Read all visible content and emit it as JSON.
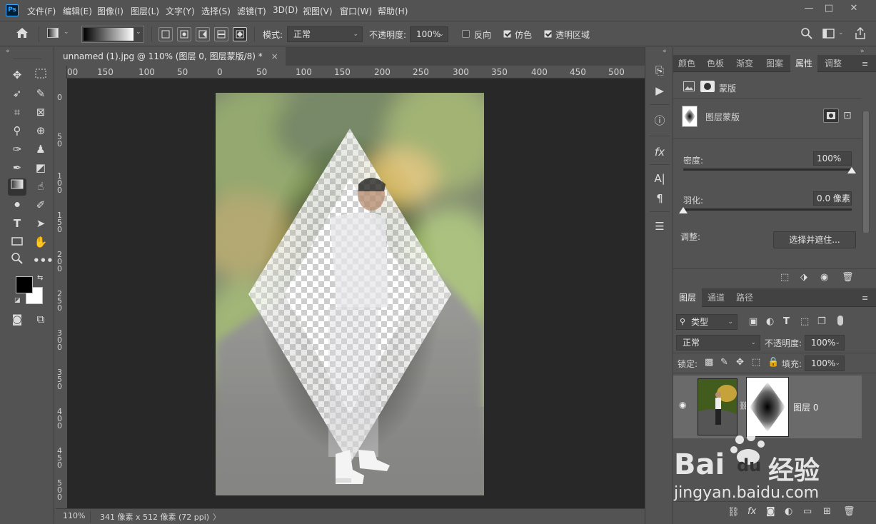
{
  "app": {
    "logo": "Ps"
  },
  "menu": [
    "文件(F)",
    "编辑(E)",
    "图像(I)",
    "图层(L)",
    "文字(Y)",
    "选择(S)",
    "滤镜(T)",
    "3D(D)",
    "视图(V)",
    "窗口(W)",
    "帮助(H)"
  ],
  "window_controls": {
    "minimize": "—",
    "maximize": "□",
    "close": "✕"
  },
  "options": {
    "mode_label": "模式:",
    "mode_value": "正常",
    "opacity_label": "不透明度:",
    "opacity_value": "100%",
    "reverse_label": "反向",
    "reverse_checked": false,
    "dither_label": "仿色",
    "dither_checked": true,
    "transparency_label": "透明区域",
    "transparency_checked": true
  },
  "document": {
    "tab_title": "unnamed (1).jpg @ 110% (图层 0, 图层蒙版/8) *",
    "tab_close": "×",
    "zoom": "110%",
    "size_info": "341 像素 x 512 像素 (72 ppi)",
    "status_arrow": "〉"
  },
  "ruler": {
    "h_labels": [
      "00",
      "150",
      "100",
      "50",
      "0",
      "50",
      "100",
      "150",
      "200",
      "250",
      "300",
      "350",
      "400",
      "450",
      "500"
    ],
    "v_labels": [
      "0",
      "5\n0",
      "1\n0\n0",
      "1\n5\n0",
      "2\n0\n0",
      "2\n5\n0",
      "3\n0\n0",
      "3\n5\n0",
      "4\n0\n0",
      "4\n5\n0",
      "5\n0\n0"
    ]
  },
  "properties_tabs": [
    "颜色",
    "色板",
    "渐变",
    "图案",
    "属性",
    "调整"
  ],
  "properties": {
    "mask_label": "蒙版",
    "layer_mask_label": "图层蒙版",
    "density_label": "密度:",
    "density_value": "100%",
    "density_fraction": 1.0,
    "feather_label": "羽化:",
    "feather_value": "0.0 像素",
    "feather_fraction": 0.0,
    "adjust_label": "调整:",
    "select_mask_button": "选择并遮住..."
  },
  "layers_tabs": [
    "图层",
    "通道",
    "路径"
  ],
  "layers": {
    "filter_value": "类型",
    "blend_mode": "正常",
    "opacity_label": "不透明度:",
    "opacity_value": "100%",
    "lock_label": "锁定:",
    "fill_label": "填充:",
    "fill_value": "100%",
    "items": [
      {
        "name": "图层 0",
        "visible": true
      }
    ]
  },
  "watermark": {
    "brand": "Bai",
    "brand2": "du",
    "cn": "经验",
    "url": "jingyan.baidu.com"
  },
  "colors": {
    "accent": "#31a8ff",
    "panel": "#535353",
    "canvas_bg": "#282828"
  }
}
